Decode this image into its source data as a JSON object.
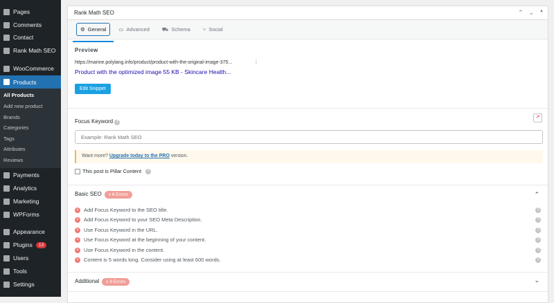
{
  "sidebar": {
    "items": [
      {
        "label": "Pages",
        "top": 0
      },
      {
        "label": "Comments"
      },
      {
        "label": "Contact"
      },
      {
        "label": "Rank Math SEO"
      },
      {
        "label": "WooCommerce"
      },
      {
        "label": "Products"
      },
      {
        "label": "Payments"
      },
      {
        "label": "Analytics"
      },
      {
        "label": "Marketing"
      },
      {
        "label": "WPForms"
      },
      {
        "label": "Appearance"
      },
      {
        "label": "Plugins",
        "badge": "13"
      },
      {
        "label": "Users"
      },
      {
        "label": "Tools"
      },
      {
        "label": "Settings"
      }
    ],
    "submenu": [
      "All Products",
      "Add new product",
      "Brands",
      "Categories",
      "Tags",
      "Attributes",
      "Reviews"
    ]
  },
  "panel": {
    "title": "Rank Math SEO",
    "tabs": [
      "General",
      "Advanced",
      "Schema",
      "Social"
    ],
    "preview_label": "Preview",
    "url": "https://marine.polylang.info/product/product-with-the-original-image-375...",
    "snippet_title": "Product with the optimized image 55 KB - Skincare Health...",
    "edit_snippet": "Edit Snippet",
    "focus_keyword_label": "Focus Keyword",
    "focus_keyword_placeholder": "Example: Rank Math SEO",
    "focus_keyword_value": "",
    "upsell_prefix": "Want more? ",
    "upsell_link": "Upgrade today to the PRO",
    "upsell_suffix": " version.",
    "pillar_label": "This post is Pillar Content",
    "basic_seo": {
      "label": "Basic SEO",
      "errors": "x 6 Errors",
      "items": [
        "Add Focus Keyword to the SEO title.",
        "Add Focus Keyword to your SEO Meta Description.",
        "Use Focus Keyword in the URL.",
        "Use Focus Keyword at the beginning of your content.",
        "Use Focus Keyword in the content.",
        "Content is 5 words long. Consider using at least 600 words."
      ]
    },
    "additional": {
      "label": "Additional",
      "errors": "x 9 Errors"
    }
  }
}
